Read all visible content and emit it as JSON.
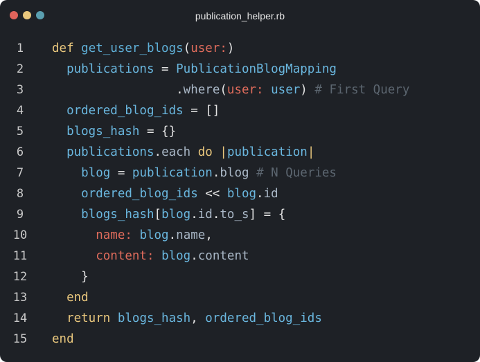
{
  "window": {
    "title": "publication_helper.rb",
    "colors": {
      "close": "#e0645c",
      "minimize": "#e9c77d",
      "maximize": "#5a9fb0",
      "background": "#1e2126"
    }
  },
  "editor": {
    "lines": [
      {
        "n": "1",
        "tokens": [
          [
            "kw",
            "def"
          ],
          [
            "pl",
            " "
          ],
          [
            "def",
            "get_user_blogs"
          ],
          [
            "op",
            "("
          ],
          [
            "sym",
            "user:"
          ],
          [
            "op",
            ")"
          ]
        ]
      },
      {
        "n": "2",
        "tokens": [
          [
            "pl",
            "  "
          ],
          [
            "id",
            "publications"
          ],
          [
            "op",
            " = "
          ],
          [
            "id",
            "PublicationBlogMapping"
          ]
        ]
      },
      {
        "n": "3",
        "tokens": [
          [
            "pl",
            "                 "
          ],
          [
            "op",
            "."
          ],
          [
            "mt",
            "where"
          ],
          [
            "op",
            "("
          ],
          [
            "sym",
            "user:"
          ],
          [
            "pl",
            " "
          ],
          [
            "id",
            "user"
          ],
          [
            "op",
            ")"
          ],
          [
            "pl",
            " "
          ],
          [
            "cm",
            "# First Query"
          ]
        ]
      },
      {
        "n": "4",
        "tokens": [
          [
            "pl",
            "  "
          ],
          [
            "id",
            "ordered_blog_ids"
          ],
          [
            "op",
            " = []"
          ]
        ]
      },
      {
        "n": "5",
        "tokens": [
          [
            "pl",
            "  "
          ],
          [
            "id",
            "blogs_hash"
          ],
          [
            "op",
            " = {}"
          ]
        ]
      },
      {
        "n": "6",
        "tokens": [
          [
            "pl",
            "  "
          ],
          [
            "id",
            "publications"
          ],
          [
            "op",
            "."
          ],
          [
            "mt",
            "each"
          ],
          [
            "pl",
            " "
          ],
          [
            "kw",
            "do"
          ],
          [
            "pl",
            " "
          ],
          [
            "kw",
            "|"
          ],
          [
            "id",
            "publication"
          ],
          [
            "kw",
            "|"
          ]
        ]
      },
      {
        "n": "7",
        "tokens": [
          [
            "pl",
            "    "
          ],
          [
            "id",
            "blog"
          ],
          [
            "op",
            " = "
          ],
          [
            "id",
            "publication"
          ],
          [
            "op",
            "."
          ],
          [
            "mt",
            "blog"
          ],
          [
            "pl",
            " "
          ],
          [
            "cm",
            "# N Queries"
          ]
        ]
      },
      {
        "n": "8",
        "tokens": [
          [
            "pl",
            "    "
          ],
          [
            "id",
            "ordered_blog_ids"
          ],
          [
            "op",
            " << "
          ],
          [
            "id",
            "blog"
          ],
          [
            "op",
            "."
          ],
          [
            "mt",
            "id"
          ]
        ]
      },
      {
        "n": "9",
        "tokens": [
          [
            "pl",
            "    "
          ],
          [
            "id",
            "blogs_hash"
          ],
          [
            "op",
            "["
          ],
          [
            "id",
            "blog"
          ],
          [
            "op",
            "."
          ],
          [
            "mt",
            "id"
          ],
          [
            "op",
            "."
          ],
          [
            "mt",
            "to_s"
          ],
          [
            "op",
            "] = {"
          ]
        ]
      },
      {
        "n": "10",
        "tokens": [
          [
            "pl",
            "      "
          ],
          [
            "sym",
            "name:"
          ],
          [
            "pl",
            " "
          ],
          [
            "id",
            "blog"
          ],
          [
            "op",
            "."
          ],
          [
            "mt",
            "name"
          ],
          [
            "op",
            ","
          ]
        ]
      },
      {
        "n": "11",
        "tokens": [
          [
            "pl",
            "      "
          ],
          [
            "sym",
            "content:"
          ],
          [
            "pl",
            " "
          ],
          [
            "id",
            "blog"
          ],
          [
            "op",
            "."
          ],
          [
            "mt",
            "content"
          ]
        ]
      },
      {
        "n": "12",
        "tokens": [
          [
            "pl",
            "    "
          ],
          [
            "op",
            "}"
          ]
        ]
      },
      {
        "n": "13",
        "tokens": [
          [
            "pl",
            "  "
          ],
          [
            "kw",
            "end"
          ]
        ]
      },
      {
        "n": "14",
        "tokens": [
          [
            "pl",
            "  "
          ],
          [
            "kw",
            "return"
          ],
          [
            "pl",
            " "
          ],
          [
            "id",
            "blogs_hash"
          ],
          [
            "op",
            ", "
          ],
          [
            "id",
            "ordered_blog_ids"
          ]
        ]
      },
      {
        "n": "15",
        "tokens": [
          [
            "kw",
            "end"
          ]
        ]
      }
    ]
  }
}
